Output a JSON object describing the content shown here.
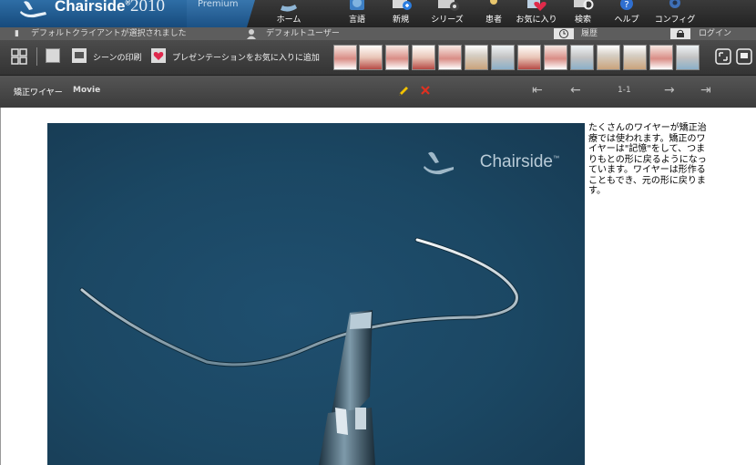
{
  "app": {
    "name": "Chairside",
    "year": "2010",
    "edition": "Premium"
  },
  "nav": {
    "items": [
      {
        "label": "ホーム",
        "icon": "home-icon"
      },
      {
        "label": "言語",
        "icon": "globe-icon"
      },
      {
        "label": "新規",
        "icon": "new-icon"
      },
      {
        "label": "シリーズ",
        "icon": "film-icon"
      },
      {
        "label": "患者",
        "icon": "patient-icon"
      },
      {
        "label": "お気に入り",
        "icon": "favorite-heart-icon"
      },
      {
        "label": "検索",
        "icon": "search-icon"
      },
      {
        "label": "ヘルプ",
        "icon": "help-icon"
      },
      {
        "label": "コンフィグ",
        "icon": "gear-icon"
      }
    ]
  },
  "status": {
    "client": "デフォルトクライアントが選択されました",
    "user": "デフォルトユーザー",
    "history": "履歴",
    "login": "ログイン"
  },
  "toolbar": {
    "print_scene": "シーンの印刷",
    "add_favorite": "プレゼンテーションをお気に入りに追加",
    "thumbnail_count": 14
  },
  "scene": {
    "title": "矯正ワイヤー",
    "type": "Movie",
    "page": "1-1",
    "watermark": "Chairside",
    "description": "たくさんのワイヤーが矯正治療では使われます。矯正のワイヤーは\"記憶\"をして、つまりもとの形に戻るようになっています。ワイヤーは形作ることもでき、元の形に戻ります。"
  },
  "colors": {
    "brand_blue": "#1b5185",
    "video_bg": "#1b4763",
    "edit_pencil": "#f2c200",
    "delete_x": "#e03020"
  }
}
